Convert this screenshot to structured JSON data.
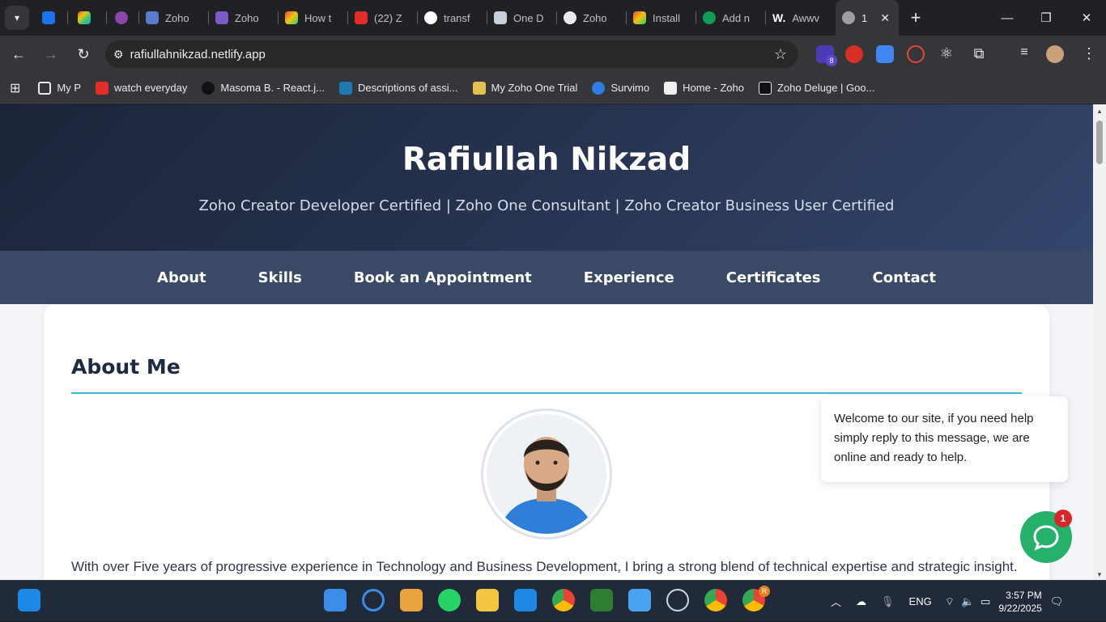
{
  "browser": {
    "tabs": [
      {
        "label": ""
      },
      {
        "label": ""
      },
      {
        "label": ""
      },
      {
        "label": "Zoho"
      },
      {
        "label": "Zoho"
      },
      {
        "label": "How t"
      },
      {
        "label": "(22) Z"
      },
      {
        "label": "transf"
      },
      {
        "label": "One D"
      },
      {
        "label": "Zoho"
      },
      {
        "label": "Install"
      },
      {
        "label": "Add n"
      },
      {
        "label": "Awwv"
      },
      {
        "label": "1"
      }
    ],
    "url": "rafiullahnikzad.netlify.app",
    "extension_badge": "8",
    "bookmarks": [
      {
        "label": "My P"
      },
      {
        "label": "watch everyday"
      },
      {
        "label": "Masoma B. - React.j..."
      },
      {
        "label": "Descriptions of assi..."
      },
      {
        "label": "My Zoho One Trial"
      },
      {
        "label": "Survimo"
      },
      {
        "label": "Home - Zoho"
      },
      {
        "label": "Zoho Deluge | Goo..."
      }
    ]
  },
  "page": {
    "name": "Rafiullah Nikzad",
    "tagline": "Zoho Creator Developer Certified | Zoho One Consultant | Zoho Creator Business User Certified",
    "nav": [
      "About",
      "Skills",
      "Book an Appointment",
      "Experience",
      "Certificates",
      "Contact"
    ],
    "section_title": "About Me",
    "about_text": "With over Five years of progressive experience in Technology and Business Development, I bring a strong blend of technical expertise and strategic insight."
  },
  "chat": {
    "message": "Welcome to our site, if you need help simply reply to this message, we are online and ready to help.",
    "badge": "1"
  },
  "taskbar": {
    "language": "ENG",
    "time": "3:57 PM",
    "date": "9/22/2025",
    "badge_chrome": "R"
  }
}
